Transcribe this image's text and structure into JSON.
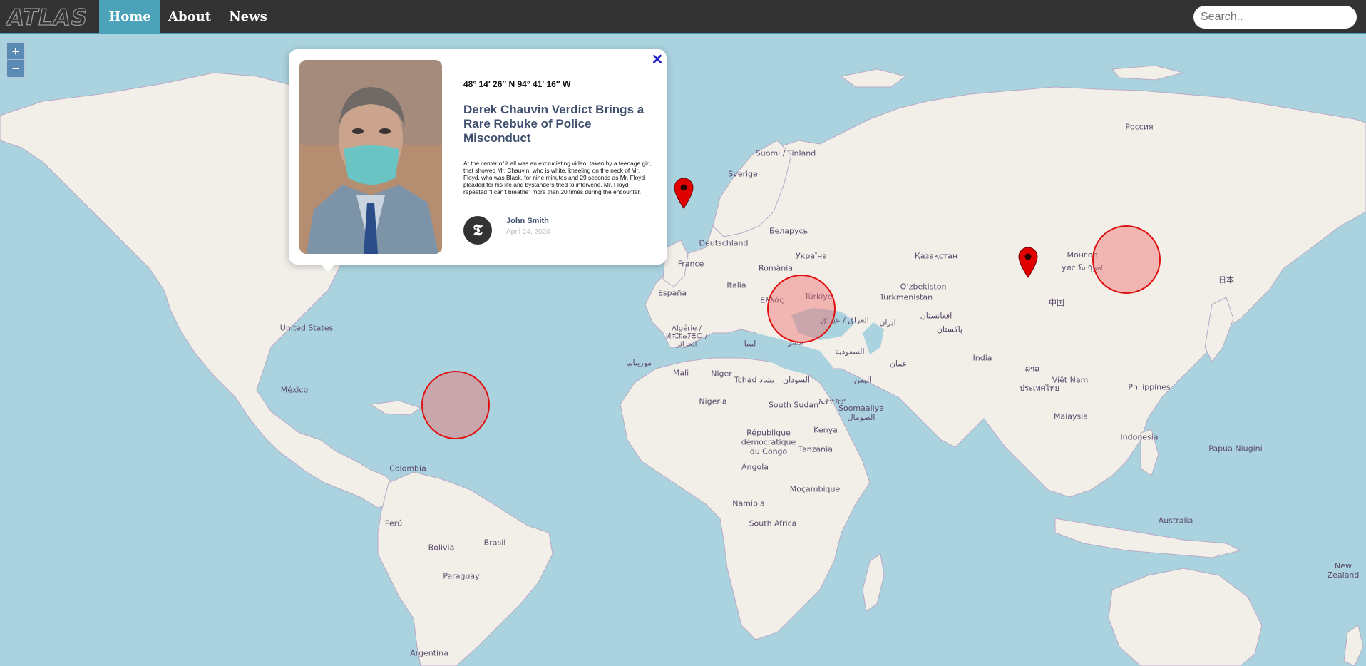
{
  "nav": {
    "logo_text": "ATLAS",
    "home": "Home",
    "about": "About",
    "news": "News",
    "search_placeholder": "Search.."
  },
  "zoom": {
    "in": "+",
    "out": "−"
  },
  "popup": {
    "coords": "48° 14′ 26″ N 94° 41′ 16″ W",
    "title": "Derek Chauvin Verdict Brings a Rare Rebuke of Police Misconduct",
    "body": "At the center of it all was an excruciating video, taken by a teenage girl, that showed Mr. Chauvin, who is white, kneeling on the neck of Mr. Floyd, who was Black, for nine minutes and 29 seconds as Mr. Floyd pleaded for his life and bystanders tried to intervene. Mr. Floyd repeated “I can’t breathe” more than 20 times during the encounter.",
    "author": "John Smith",
    "date": "April 24, 2020",
    "source_logo": "𝕿",
    "close": "✕"
  },
  "labels": [
    {
      "text": "United States"
    },
    {
      "text": "México"
    },
    {
      "text": "Colombia"
    },
    {
      "text": "Perú"
    },
    {
      "text": "Bolivia"
    },
    {
      "text": "Brasil"
    },
    {
      "text": "Paraguay"
    },
    {
      "text": "Argentina"
    },
    {
      "text": "Suomi / Finland"
    },
    {
      "text": "Sverige"
    },
    {
      "text": "Россия"
    },
    {
      "text": "Беларусь"
    },
    {
      "text": "Deutschland"
    },
    {
      "text": "France"
    },
    {
      "text": "Україна"
    },
    {
      "text": "România"
    },
    {
      "text": "España"
    },
    {
      "text": "Italia"
    },
    {
      "text": "Ελλάς"
    },
    {
      "text": "Türkiye"
    },
    {
      "text": "Қазақстан"
    },
    {
      "text": "Монгол улс ᠮᠣᠩᠭᠣᠯ"
    },
    {
      "text": "日本"
    },
    {
      "text": "O‘zbekiston"
    },
    {
      "text": "Turkmenistan"
    },
    {
      "text": "中国"
    },
    {
      "text": "Algérie / ⵍⵣⵣⴰⵢⴻⵔ / الجزائر"
    },
    {
      "text": "ليبيا"
    },
    {
      "text": "مصر"
    },
    {
      "text": "العراق / عێراق"
    },
    {
      "text": "ایران"
    },
    {
      "text": "افغانستان"
    },
    {
      "text": "پاکستان"
    },
    {
      "text": "السعودية"
    },
    {
      "text": "عمان"
    },
    {
      "text": "India"
    },
    {
      "text": "موريتانيا"
    },
    {
      "text": "Mali"
    },
    {
      "text": "Niger"
    },
    {
      "text": "Tchad تشاد"
    },
    {
      "text": "السودان"
    },
    {
      "text": "اليمن"
    },
    {
      "text": "Nigeria"
    },
    {
      "text": "ኢትዮጵያ"
    },
    {
      "text": "South Sudan"
    },
    {
      "text": "Soomaaliya الصومال"
    },
    {
      "text": "Kenya"
    },
    {
      "text": "République démocratique du Congo"
    },
    {
      "text": "Tanzania"
    },
    {
      "text": "Angola"
    },
    {
      "text": "Moçambique"
    },
    {
      "text": "Namibia"
    },
    {
      "text": "South Africa"
    },
    {
      "text": "Việt Nam"
    },
    {
      "text": "ประเทศไทย"
    },
    {
      "text": "Philippines"
    },
    {
      "text": "Malaysia"
    },
    {
      "text": "Indonesia"
    },
    {
      "text": "Papua Niugini"
    },
    {
      "text": "Australia"
    },
    {
      "text": "New Zealand"
    },
    {
      "text": "ລາວ"
    }
  ],
  "colors": {
    "navbar": "#333333",
    "nav_active": "#4ba2b9",
    "ocean": "#aad3df",
    "land": "#f2efe9",
    "marker": "#e00000",
    "circle_stroke": "#e01010"
  }
}
